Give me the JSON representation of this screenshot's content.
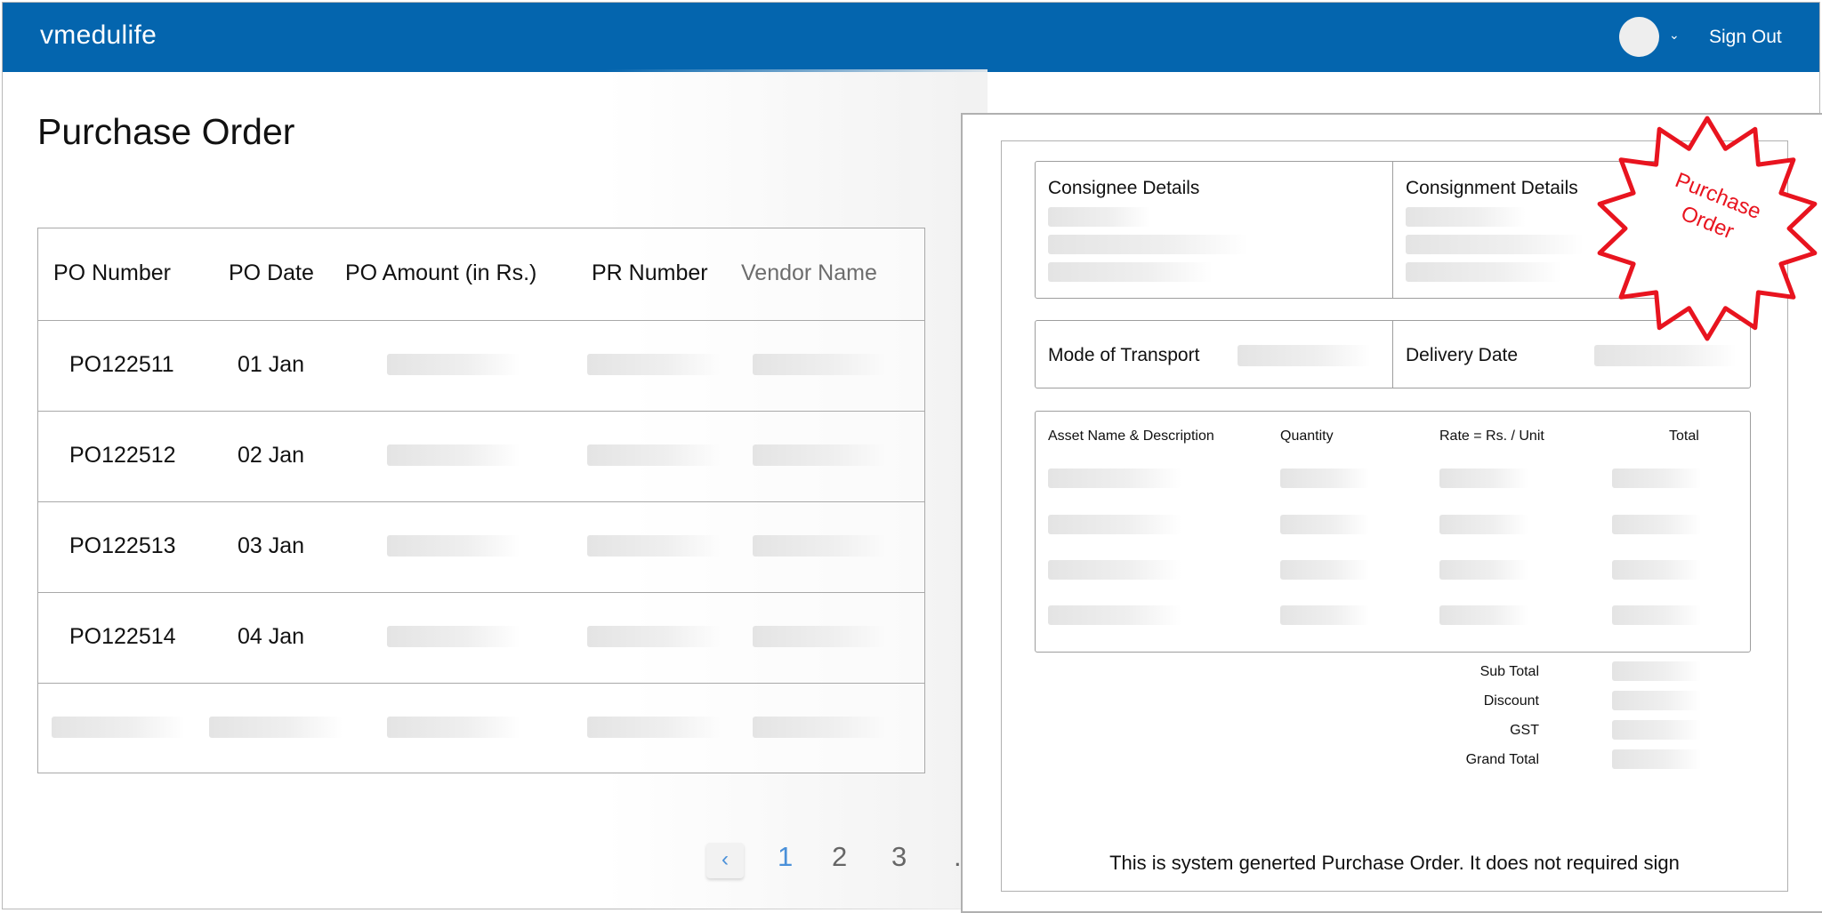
{
  "header": {
    "brand": "vmedulife",
    "sign_out": "Sign Out",
    "caret": "⌄"
  },
  "page": {
    "title": "Purchase Order"
  },
  "table": {
    "columns": [
      "PO Number",
      "PO Date",
      "PO Amount (in Rs.)",
      "PR Number",
      "Vendor Name"
    ],
    "rows": [
      {
        "po_number": "PO122511",
        "po_date": "01 Jan"
      },
      {
        "po_number": "PO122512",
        "po_date": "02 Jan"
      },
      {
        "po_number": "PO122513",
        "po_date": "03 Jan"
      },
      {
        "po_number": "PO122514",
        "po_date": "04 Jan"
      }
    ]
  },
  "pagination": {
    "prev": "‹",
    "pages": [
      "1",
      "2",
      "3",
      "."
    ],
    "active_page": "1"
  },
  "po_document": {
    "consignee_label": "Consignee Details",
    "consignment_label": "Consignment Details",
    "transport_label": "Mode of Transport",
    "delivery_label": "Delivery Date",
    "items_columns": [
      "Asset Name & Description",
      "Quantity",
      "Rate = Rs. / Unit",
      "Total"
    ],
    "summary_labels": [
      "Sub Total",
      "Discount",
      "GST",
      "Grand Total"
    ],
    "footer": "This is system generted Purchase Order. It does not required sign"
  },
  "stamp": {
    "line1": "Purchase",
    "line2": "Order",
    "color": "#e8141f"
  },
  "colors": {
    "header_bg": "#0465ae",
    "accent": "#4a90d9"
  }
}
